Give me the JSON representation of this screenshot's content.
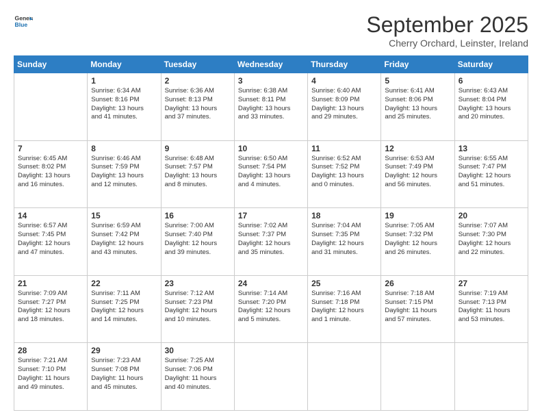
{
  "header": {
    "logo_line1": "General",
    "logo_line2": "Blue",
    "month": "September 2025",
    "location": "Cherry Orchard, Leinster, Ireland"
  },
  "weekdays": [
    "Sunday",
    "Monday",
    "Tuesday",
    "Wednesday",
    "Thursday",
    "Friday",
    "Saturday"
  ],
  "weeks": [
    [
      {
        "day": "",
        "info": ""
      },
      {
        "day": "1",
        "info": "Sunrise: 6:34 AM\nSunset: 8:16 PM\nDaylight: 13 hours\nand 41 minutes."
      },
      {
        "day": "2",
        "info": "Sunrise: 6:36 AM\nSunset: 8:13 PM\nDaylight: 13 hours\nand 37 minutes."
      },
      {
        "day": "3",
        "info": "Sunrise: 6:38 AM\nSunset: 8:11 PM\nDaylight: 13 hours\nand 33 minutes."
      },
      {
        "day": "4",
        "info": "Sunrise: 6:40 AM\nSunset: 8:09 PM\nDaylight: 13 hours\nand 29 minutes."
      },
      {
        "day": "5",
        "info": "Sunrise: 6:41 AM\nSunset: 8:06 PM\nDaylight: 13 hours\nand 25 minutes."
      },
      {
        "day": "6",
        "info": "Sunrise: 6:43 AM\nSunset: 8:04 PM\nDaylight: 13 hours\nand 20 minutes."
      }
    ],
    [
      {
        "day": "7",
        "info": "Sunrise: 6:45 AM\nSunset: 8:02 PM\nDaylight: 13 hours\nand 16 minutes."
      },
      {
        "day": "8",
        "info": "Sunrise: 6:46 AM\nSunset: 7:59 PM\nDaylight: 13 hours\nand 12 minutes."
      },
      {
        "day": "9",
        "info": "Sunrise: 6:48 AM\nSunset: 7:57 PM\nDaylight: 13 hours\nand 8 minutes."
      },
      {
        "day": "10",
        "info": "Sunrise: 6:50 AM\nSunset: 7:54 PM\nDaylight: 13 hours\nand 4 minutes."
      },
      {
        "day": "11",
        "info": "Sunrise: 6:52 AM\nSunset: 7:52 PM\nDaylight: 13 hours\nand 0 minutes."
      },
      {
        "day": "12",
        "info": "Sunrise: 6:53 AM\nSunset: 7:49 PM\nDaylight: 12 hours\nand 56 minutes."
      },
      {
        "day": "13",
        "info": "Sunrise: 6:55 AM\nSunset: 7:47 PM\nDaylight: 12 hours\nand 51 minutes."
      }
    ],
    [
      {
        "day": "14",
        "info": "Sunrise: 6:57 AM\nSunset: 7:45 PM\nDaylight: 12 hours\nand 47 minutes."
      },
      {
        "day": "15",
        "info": "Sunrise: 6:59 AM\nSunset: 7:42 PM\nDaylight: 12 hours\nand 43 minutes."
      },
      {
        "day": "16",
        "info": "Sunrise: 7:00 AM\nSunset: 7:40 PM\nDaylight: 12 hours\nand 39 minutes."
      },
      {
        "day": "17",
        "info": "Sunrise: 7:02 AM\nSunset: 7:37 PM\nDaylight: 12 hours\nand 35 minutes."
      },
      {
        "day": "18",
        "info": "Sunrise: 7:04 AM\nSunset: 7:35 PM\nDaylight: 12 hours\nand 31 minutes."
      },
      {
        "day": "19",
        "info": "Sunrise: 7:05 AM\nSunset: 7:32 PM\nDaylight: 12 hours\nand 26 minutes."
      },
      {
        "day": "20",
        "info": "Sunrise: 7:07 AM\nSunset: 7:30 PM\nDaylight: 12 hours\nand 22 minutes."
      }
    ],
    [
      {
        "day": "21",
        "info": "Sunrise: 7:09 AM\nSunset: 7:27 PM\nDaylight: 12 hours\nand 18 minutes."
      },
      {
        "day": "22",
        "info": "Sunrise: 7:11 AM\nSunset: 7:25 PM\nDaylight: 12 hours\nand 14 minutes."
      },
      {
        "day": "23",
        "info": "Sunrise: 7:12 AM\nSunset: 7:23 PM\nDaylight: 12 hours\nand 10 minutes."
      },
      {
        "day": "24",
        "info": "Sunrise: 7:14 AM\nSunset: 7:20 PM\nDaylight: 12 hours\nand 5 minutes."
      },
      {
        "day": "25",
        "info": "Sunrise: 7:16 AM\nSunset: 7:18 PM\nDaylight: 12 hours\nand 1 minute."
      },
      {
        "day": "26",
        "info": "Sunrise: 7:18 AM\nSunset: 7:15 PM\nDaylight: 11 hours\nand 57 minutes."
      },
      {
        "day": "27",
        "info": "Sunrise: 7:19 AM\nSunset: 7:13 PM\nDaylight: 11 hours\nand 53 minutes."
      }
    ],
    [
      {
        "day": "28",
        "info": "Sunrise: 7:21 AM\nSunset: 7:10 PM\nDaylight: 11 hours\nand 49 minutes."
      },
      {
        "day": "29",
        "info": "Sunrise: 7:23 AM\nSunset: 7:08 PM\nDaylight: 11 hours\nand 45 minutes."
      },
      {
        "day": "30",
        "info": "Sunrise: 7:25 AM\nSunset: 7:06 PM\nDaylight: 11 hours\nand 40 minutes."
      },
      {
        "day": "",
        "info": ""
      },
      {
        "day": "",
        "info": ""
      },
      {
        "day": "",
        "info": ""
      },
      {
        "day": "",
        "info": ""
      }
    ]
  ]
}
